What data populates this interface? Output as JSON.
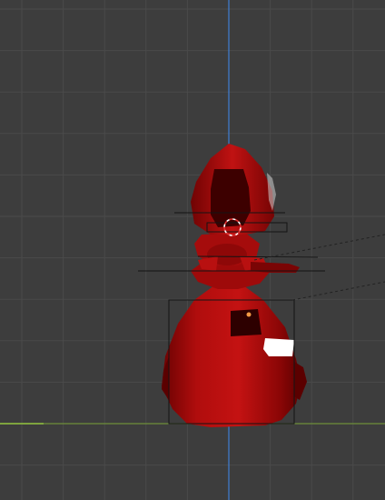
{
  "viewport": {
    "background": "#3d3d3d",
    "grid_color": "#4a4a4a",
    "grid_major_color": "#505050",
    "z_axis_color": "#3f7fd6",
    "x_axis_color": "#7aa33b",
    "object_color": "#a10a0a",
    "object_dark_color": "#5a0000",
    "object_highlight_color": "#d41515",
    "wire_color": "#1a1a1a",
    "origin_color": "#f29a45",
    "cursor_colors": [
      "#ffffff",
      "#e03030"
    ]
  },
  "tools": {
    "view3d_cursor": "3d-cursor-icon",
    "object_origin": "object-origin-dot"
  }
}
